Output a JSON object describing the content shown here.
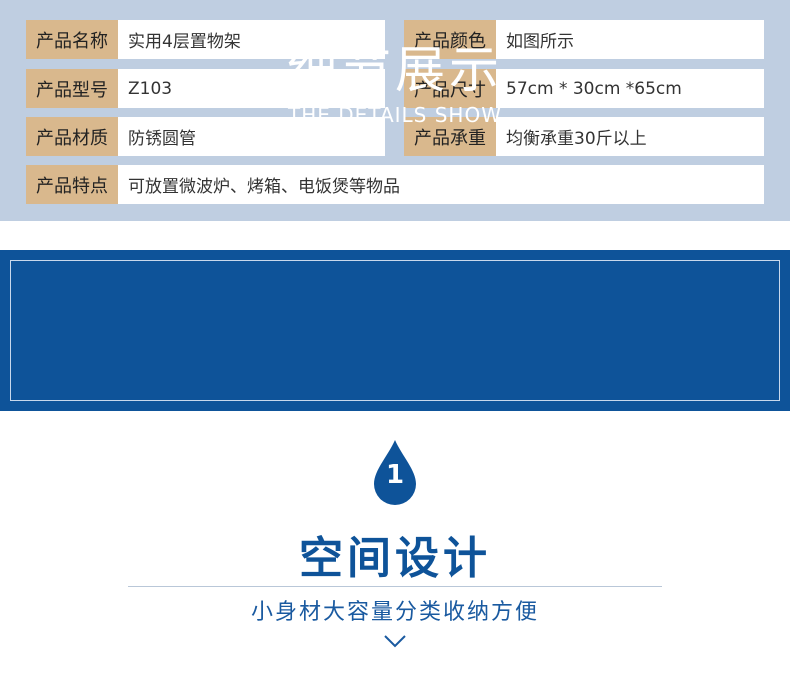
{
  "specs": {
    "name": {
      "label": "产品名称",
      "value": "实用4层置物架"
    },
    "color": {
      "label": "产品颜色",
      "value": "如图所示"
    },
    "model": {
      "label": "产品型号",
      "value": "Z103"
    },
    "size": {
      "label": "产品尺寸",
      "value": "57cm * 30cm *65cm"
    },
    "material": {
      "label": "产品材质",
      "value": "防锈圆管"
    },
    "load": {
      "label": "产品承重",
      "value": "均衡承重30斤以上"
    },
    "feature": {
      "label": "产品特点",
      "value": "可放置微波炉、烤箱、电饭煲等物品"
    }
  },
  "banner": {
    "title": "细节展示",
    "subtitle": "THE DETAILS SHOW"
  },
  "section": {
    "number": "1",
    "title": "空间设计",
    "subtitle": "小身材大容量分类收纳方便"
  },
  "colors": {
    "panel_bg": "#bfcee1",
    "label_bg": "#d9b88d",
    "brand_blue": "#0e5399"
  },
  "icons": {
    "drop": "water-drop-icon",
    "chevron": "chevron-down-icon"
  }
}
